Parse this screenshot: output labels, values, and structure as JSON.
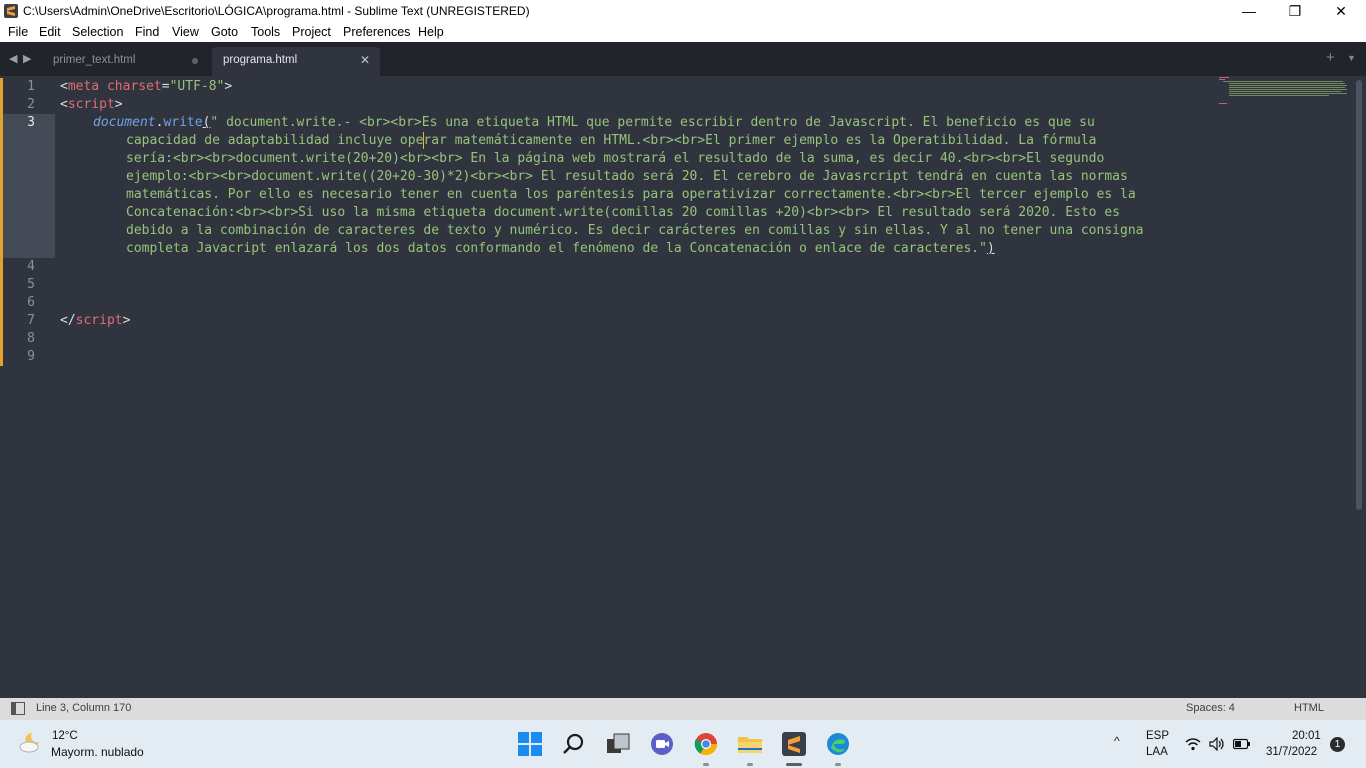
{
  "window": {
    "title": "C:\\Users\\Admin\\OneDrive\\Escritorio\\LÓGICA\\programa.html - Sublime Text (UNREGISTERED)",
    "minimize": "—",
    "maximize": "❐",
    "close": "✕"
  },
  "menu": [
    "File",
    "Edit",
    "Selection",
    "Find",
    "View",
    "Goto",
    "Tools",
    "Project",
    "Preferences",
    "Help"
  ],
  "tabs": [
    {
      "label": "primer_text.html",
      "active": false
    },
    {
      "label": "programa.html",
      "active": true
    }
  ],
  "tab_close": "✕",
  "tab_plus": "+",
  "tab_list": "▼",
  "line_numbers": [
    "1",
    "2",
    "3",
    "4",
    "5",
    "6",
    "7",
    "8",
    "9"
  ],
  "code": {
    "l1_open": "<",
    "l1_tag": "meta",
    "l1_attr": " charset",
    "l1_eq": "=",
    "l1_val": "\"UTF-8\"",
    "l1_close": ">",
    "l2_open": "<",
    "l2_tag": "script",
    "l2_close": ">",
    "l3_obj": "document",
    "l3_dot": ".",
    "l3_fn": "write",
    "l3_paren": "(",
    "l3_wrap1": "\" document.write.- <br><br>Es una etiqueta HTML que permite escribir dentro de Javascript. El beneficio es que su",
    "l3_wrap2": "capacidad de adaptabilidad incluye operar matemáticamente en HTML.<br><br>El primer ejemplo es la Operatibilidad. La fórmula",
    "l3_wrap3": "sería:<br><br>document.write(20+20)<br><br> En la página web mostrará el resultado de la suma, es decir 40.<br><br>El segundo",
    "l3_wrap4": "ejemplo:<br><br>document.write((20+20-30)*2)<br><br> El resultado será 20. El cerebro de Javasrcript tendrá en cuenta las normas",
    "l3_wrap5": "matemáticas. Por ello es necesario tener en cuenta los paréntesis para operativizar correctamente.<br><br>El tercer ejemplo es la",
    "l3_wrap6": "Concatenación:<br><br>Si uso la misma etiqueta document.write(comillas 20 comillas +20)<br><br> El resultado será 2020. Esto es",
    "l3_wrap7": "debido a la combinación de caracteres de texto y numérico. Es decir carácteres en comillas y sin ellas. Y al no tener una consigna",
    "l3_wrap8": "completa Javacript enlazará los dos datos conformando el fenómeno de la Concatenación o enlace de caracteres.\"",
    "l3_end": ")",
    "l7_open": "</",
    "l7_tag": "script",
    "l7_close": ">"
  },
  "status": {
    "position": "Line 3, Column 170",
    "spaces": "Spaces: 4",
    "syntax": "HTML"
  },
  "taskbar": {
    "weather_temp": "12°C",
    "weather_desc": "Mayorm. nublado",
    "tray_chevron": "^",
    "lang_1": "ESP",
    "lang_2": "LAA",
    "time": "20:01",
    "date": "31/7/2022",
    "notifications": "1"
  },
  "colors": {
    "editor_bg": "#2f343f",
    "tab_bg": "#21252b",
    "modified_marker": "#e5a12f",
    "tag": "#e06c75",
    "string": "#98c379",
    "function": "#6ea3e6"
  }
}
